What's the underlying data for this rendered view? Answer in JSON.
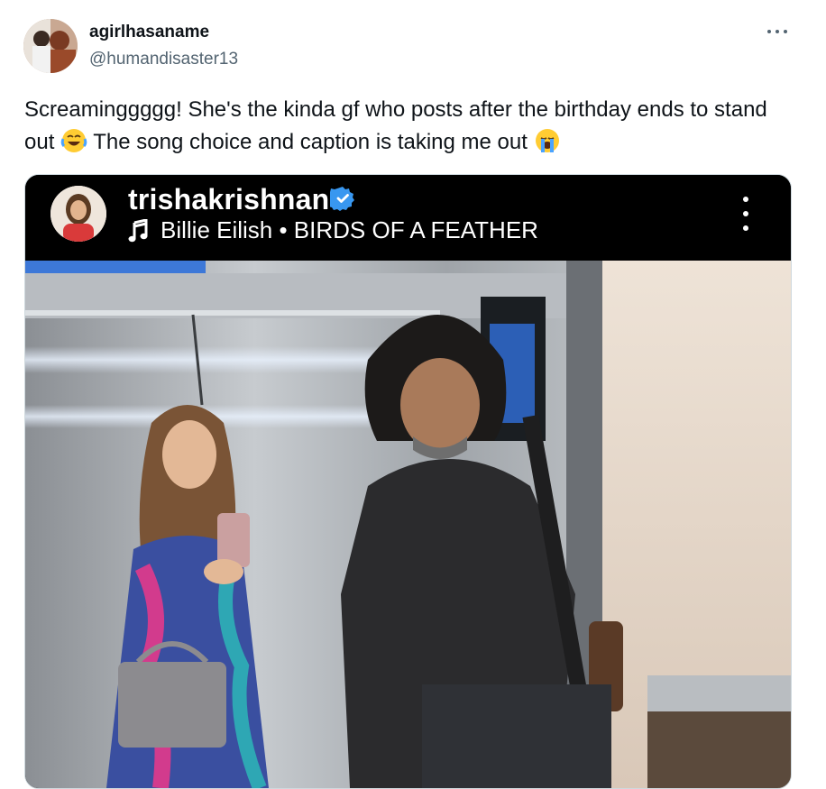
{
  "tweet": {
    "display_name": "agirlhasaname",
    "handle": "@humandisaster13",
    "more_icon": "more-horizontal-icon",
    "text_part1": "Screaminggggg! She's the kinda gf who posts after the birthday ends to stand out ",
    "emoji1": "face-with-tears-of-joy-emoji",
    "text_part2": " The song choice and caption is taking me out ",
    "emoji2": "loudly-crying-face-emoji"
  },
  "embedded_post": {
    "username": "trishakrishnan",
    "verified_icon": "verified-badge-icon",
    "music_icon": "music-note-icon",
    "song": "Billie Eilish • BIRDS OF A FEATHER",
    "more_icon": "more-vertical-icon",
    "photo_description_icon": "elevator-mirror-selfie-photo"
  },
  "colors": {
    "text_primary": "#0f1419",
    "text_secondary": "#536471",
    "verified_blue": "#3897f0",
    "ig_header_bg": "#000000"
  }
}
